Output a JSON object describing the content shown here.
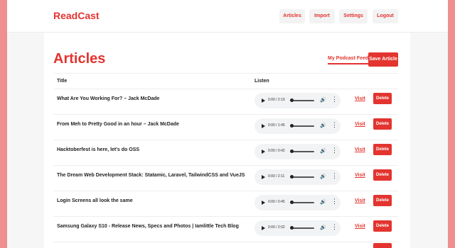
{
  "brand": "ReadCast",
  "nav": {
    "items": [
      {
        "label": "Articles"
      },
      {
        "label": "Import"
      },
      {
        "label": "Settings"
      },
      {
        "label": "Logout"
      }
    ]
  },
  "page": {
    "title": "Articles",
    "feed_link": "My Podcast Feed",
    "save_label": "Save Article"
  },
  "table": {
    "headers": {
      "title": "Title",
      "listen": "Listen"
    },
    "visit_label": "Visit",
    "delete_label": "Delete",
    "rows": [
      {
        "title": "What Are You Working For? – Jack McDade",
        "time": "0:00 / 2:19"
      },
      {
        "title": "From Meh to Pretty Good in an hour – Jack McDade",
        "time": "0:00 / 1:45"
      },
      {
        "title": "Hacktoberfest is here, let's do OSS",
        "time": "0:00 / 0:42"
      },
      {
        "title": "The Dream Web Development Stack: Statamic, Laravel, TailwindCSS and VueJS",
        "time": "0:00 / 2:11"
      },
      {
        "title": "Login Screens all look the same",
        "time": "0:00 / 0:45"
      },
      {
        "title": "Samsung Galaxy S10 - Release News, Specs and Photos | Iamlittle Tech Blog",
        "time": "0:00 / 2:02"
      }
    ]
  },
  "icons": {
    "play": "play-icon",
    "volume": "volume-icon",
    "more": "more-vertical-icon"
  },
  "colors": {
    "accent": "#e3342f",
    "background": "#f6f6f7",
    "outer": "#f08f8f"
  }
}
